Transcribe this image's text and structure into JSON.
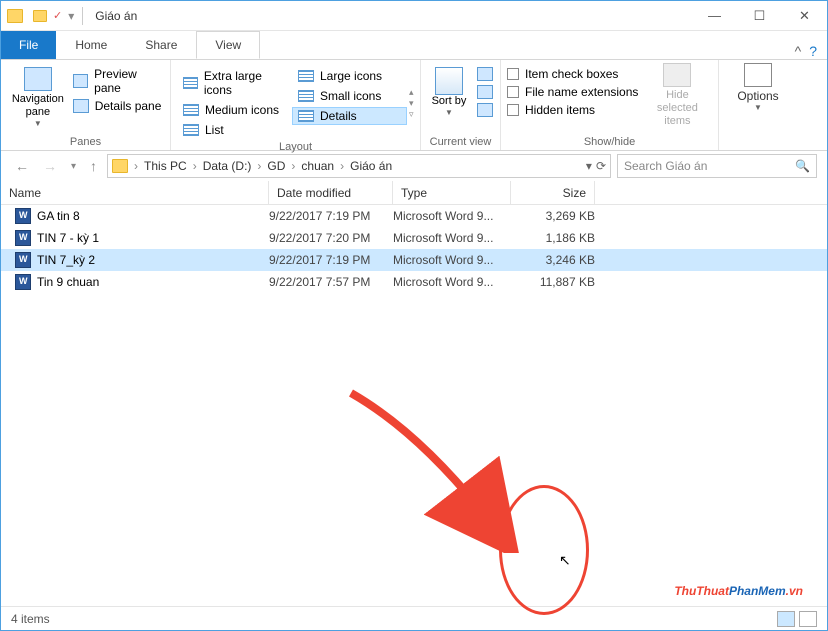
{
  "window": {
    "title": "Giáo án"
  },
  "tabs": {
    "file": "File",
    "home": "Home",
    "share": "Share",
    "view": "View"
  },
  "ribbon": {
    "panes": {
      "nav": "Navigation pane",
      "preview": "Preview pane",
      "details": "Details pane",
      "label": "Panes"
    },
    "layout": {
      "items": [
        "Extra large icons",
        "Large icons",
        "Medium icons",
        "Small icons",
        "List",
        "Details"
      ],
      "label": "Layout"
    },
    "current": {
      "sort": "Sort by",
      "label": "Current view"
    },
    "showhide": {
      "chk1": "Item check boxes",
      "chk2": "File name extensions",
      "chk3": "Hidden items",
      "hide": "Hide selected items",
      "label": "Show/hide"
    },
    "options": "Options"
  },
  "breadcrumb": [
    "This PC",
    "Data (D:)",
    "GD",
    "chuan",
    "Giáo án"
  ],
  "search_placeholder": "Search Giáo án",
  "columns": {
    "name": "Name",
    "date": "Date modified",
    "type": "Type",
    "size": "Size"
  },
  "files": [
    {
      "name": "GA tin 8",
      "date": "9/22/2017 7:19 PM",
      "type": "Microsoft Word 9...",
      "size": "3,269 KB",
      "selected": false
    },
    {
      "name": "TIN 7 - kỳ 1",
      "date": "9/22/2017 7:20 PM",
      "type": "Microsoft Word 9...",
      "size": "1,186 KB",
      "selected": false
    },
    {
      "name": "TIN 7_kỳ 2",
      "date": "9/22/2017 7:19 PM",
      "type": "Microsoft Word 9...",
      "size": "3,246 KB",
      "selected": true
    },
    {
      "name": "Tin 9 chuan",
      "date": "9/22/2017 7:57 PM",
      "type": "Microsoft Word 9...",
      "size": "11,887 KB",
      "selected": false
    }
  ],
  "status": "4 items",
  "watermark": {
    "a": "ThuThuat",
    "b": "PhanMem",
    "c": ".vn"
  }
}
